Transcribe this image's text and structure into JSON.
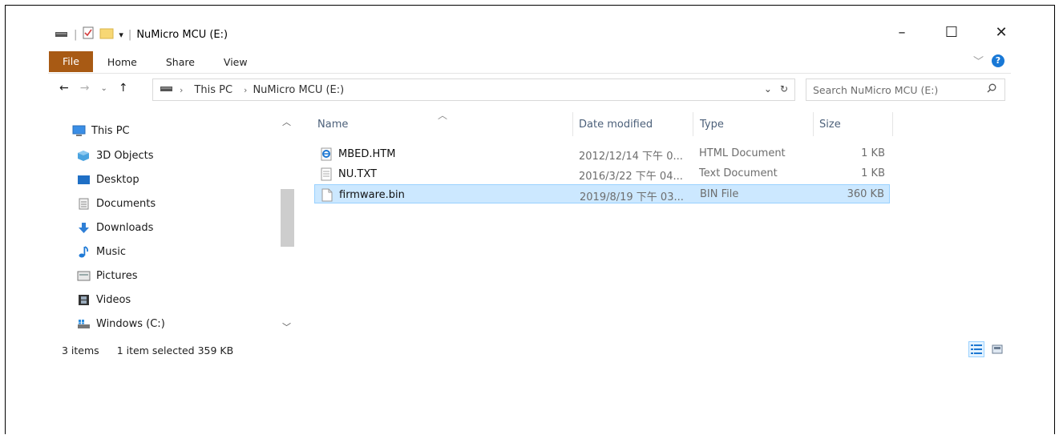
{
  "window": {
    "title": "NuMicro MCU (E:)",
    "controls": {
      "minimize": "–",
      "maximize": "☐",
      "close": "✕"
    }
  },
  "ribbon": {
    "tabs": [
      "File",
      "Home",
      "Share",
      "View"
    ],
    "file_color": "#a85a14"
  },
  "address": {
    "crumbs": [
      "This PC",
      "NuMicro MCU (E:)"
    ]
  },
  "search": {
    "placeholder": "Search NuMicro MCU (E:)"
  },
  "sidebar": {
    "items": [
      {
        "label": "This PC",
        "icon": "monitor-icon"
      },
      {
        "label": "3D Objects",
        "icon": "cube-icon"
      },
      {
        "label": "Desktop",
        "icon": "desktop-icon"
      },
      {
        "label": "Documents",
        "icon": "documents-icon"
      },
      {
        "label": "Downloads",
        "icon": "download-icon"
      },
      {
        "label": "Music",
        "icon": "music-note-icon"
      },
      {
        "label": "Pictures",
        "icon": "pictures-icon"
      },
      {
        "label": "Videos",
        "icon": "film-icon"
      },
      {
        "label": "Windows (C:)",
        "icon": "drive-icon"
      }
    ]
  },
  "columns": [
    "Name",
    "Date modified",
    "Type",
    "Size"
  ],
  "files": [
    {
      "name": "MBED.HTM",
      "date": "2012/12/14 下午 0...",
      "type": "HTML Document",
      "size": "1 KB",
      "icon": "ie-file-icon",
      "selected": false
    },
    {
      "name": "NU.TXT",
      "date": "2016/3/22 下午 04...",
      "type": "Text Document",
      "size": "1 KB",
      "icon": "text-file-icon",
      "selected": false
    },
    {
      "name": "firmware.bin",
      "date": "2019/8/19 下午 03...",
      "type": "BIN File",
      "size": "360 KB",
      "icon": "blank-file-icon",
      "selected": true
    }
  ],
  "status": {
    "count": "3 items",
    "selection": "1 item selected  359 KB"
  }
}
